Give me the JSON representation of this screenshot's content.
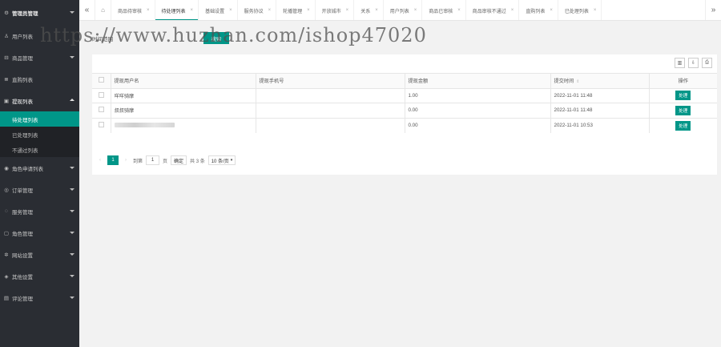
{
  "sidebar": {
    "top": {
      "label": "管理员管理",
      "icon": "gear-icon"
    },
    "items": [
      {
        "label": "用户列表",
        "icon": "user-icon"
      },
      {
        "label": "商品管理",
        "icon": "cart-icon"
      },
      {
        "label": "直购列表",
        "icon": "list-icon"
      }
    ],
    "open_group": {
      "label": "提现列表",
      "icon": "note-icon",
      "subitems": [
        "待处理列表",
        "已处理列表",
        "不通过列表"
      ]
    },
    "rest": [
      {
        "label": "角色申请列表",
        "icon": "check-circle-icon"
      },
      {
        "label": "订单管理",
        "icon": "target-icon"
      },
      {
        "label": "服务管理",
        "icon": "service-icon"
      },
      {
        "label": "角色管理",
        "icon": "role-icon"
      },
      {
        "label": "网站设置",
        "icon": "settings-icon"
      },
      {
        "label": "其他设置",
        "icon": "shield-icon"
      },
      {
        "label": "评论管理",
        "icon": "comment-icon"
      }
    ]
  },
  "tabs": [
    "商品待审核",
    "待处理列表",
    "基础设置",
    "服务协议",
    "轮播管理",
    "开放城市",
    "关系",
    "用户列表",
    "商品已审核",
    "商品审核不通过",
    "直购列表",
    "已处理列表"
  ],
  "active_tab": 1,
  "filter": {
    "label": "时间范围",
    "search_label": "搜索"
  },
  "table": {
    "headers": [
      "提现用户名",
      "提现手机号",
      "提现金额",
      "提交时间",
      "操作"
    ],
    "rows": [
      {
        "name": "咩咩骑摩",
        "phone": "",
        "amount": "1.00",
        "time": "2022-11-01 11:48",
        "action": "处理"
      },
      {
        "name": "叔叔骑摩",
        "phone": "",
        "amount": "0.00",
        "time": "2022-11-01 11:48",
        "action": "处理"
      },
      {
        "name": "",
        "phone": "",
        "amount": "0.00",
        "time": "2022-11-01 10:53",
        "action": "处理"
      }
    ]
  },
  "pager": {
    "current": "1",
    "goto_label": "到第",
    "page_input": "1",
    "page_suffix": "页",
    "confirm": "确定",
    "total": "共 3 条",
    "size": "10 条/页"
  },
  "watermark": "https://www.huzhan.com/ishop47020",
  "colors": {
    "accent": "#009688",
    "sidebar_bg": "#2a2d33"
  }
}
